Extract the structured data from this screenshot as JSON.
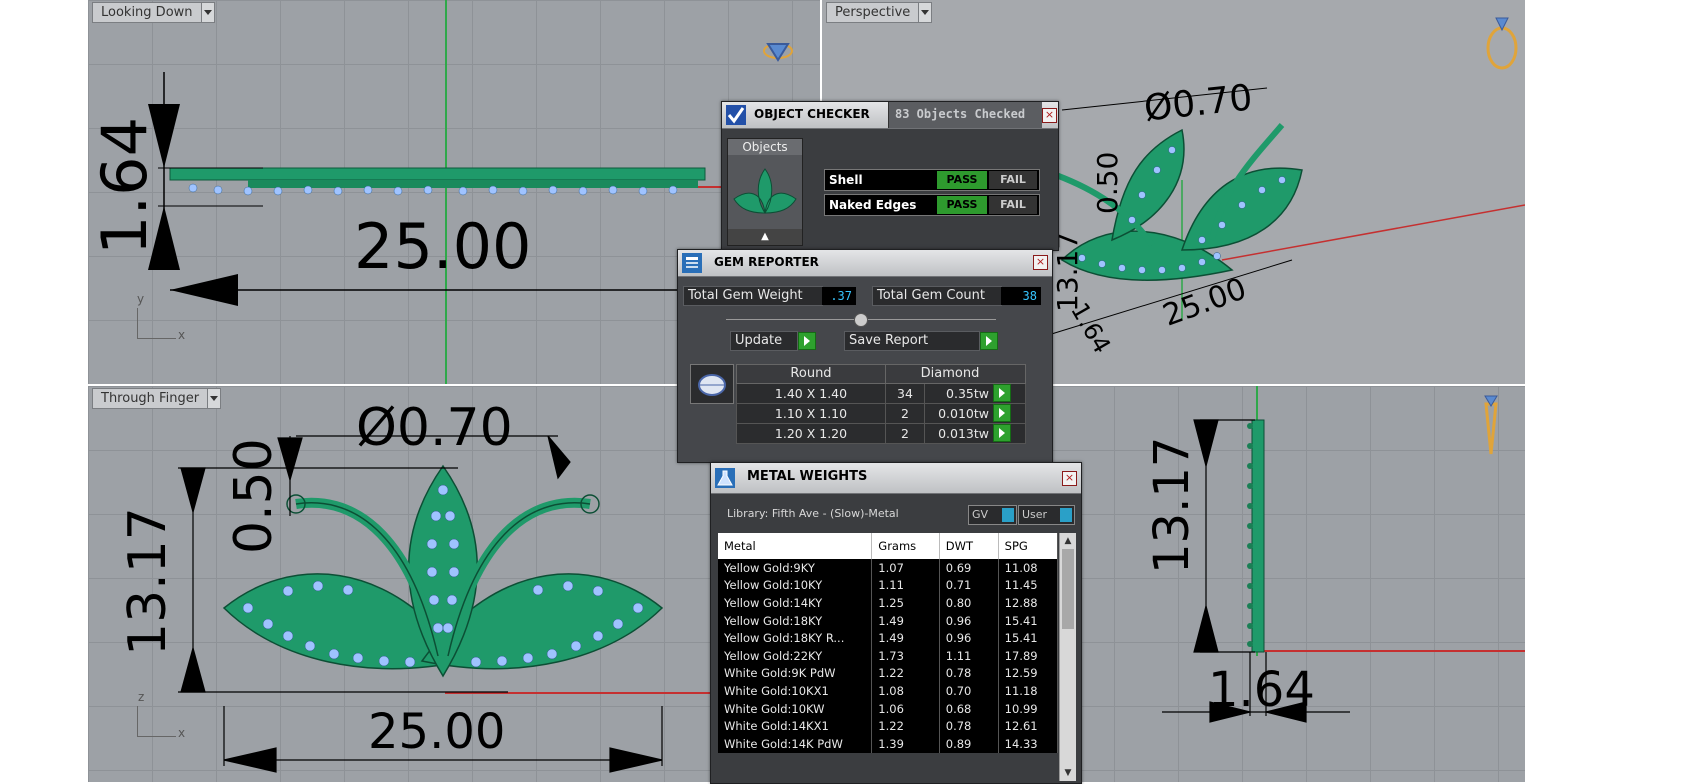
{
  "viewports": {
    "top": {
      "label": "Looking Down",
      "dim_height": "1.64",
      "dim_width": "25.00",
      "axis_y": "y",
      "axis_x": "x"
    },
    "perspective": {
      "label": "Perspective",
      "dim_diameter": "Ø0.70",
      "dim_vertical": "0.50",
      "dim_height": "13.17",
      "dim_depth": "1.64",
      "dim_width": "25.00"
    },
    "front": {
      "label": "Through Finger",
      "dim_diameter": "Ø0.70",
      "dim_small": "0.50",
      "dim_height": "13.17",
      "dim_width": "25.00",
      "axis_z": "z",
      "axis_x": "x"
    },
    "side": {
      "dim_height": "13.17",
      "dim_depth": "1.64"
    }
  },
  "object_checker": {
    "title": "OBJECT CHECKER",
    "tab_status": "83 Objects Checked",
    "objects_label": "Objects",
    "checks": [
      {
        "name": "Shell",
        "pass": "PASS",
        "fail": "FAIL"
      },
      {
        "name": "Naked Edges",
        "pass": "PASS",
        "fail": "FAIL"
      }
    ]
  },
  "gem_reporter": {
    "title": "GEM REPORTER",
    "total_weight_label": "Total Gem Weight",
    "total_weight_value": ".37",
    "total_count_label": "Total Gem Count",
    "total_count_value": "38",
    "update_label": "Update",
    "save_label": "Save Report",
    "table": {
      "shape": "Round",
      "material": "Diamond",
      "rows": [
        {
          "size": "1.40 X 1.40",
          "count": "34",
          "weight": "0.35tw"
        },
        {
          "size": "1.10 X 1.10",
          "count": "2",
          "weight": "0.010tw"
        },
        {
          "size": "1.20 X 1.20",
          "count": "2",
          "weight": "0.013tw"
        }
      ]
    }
  },
  "metal_weights": {
    "title": "METAL WEIGHTS",
    "library": "Library: Fifth Ave - (Slow)-Metal",
    "gv_label": "GV",
    "user_label": "User",
    "headers": [
      "Metal",
      "Grams",
      "DWT",
      "SPG"
    ],
    "rows": [
      [
        "Yellow Gold:9KY",
        "1.07",
        "0.69",
        "11.08"
      ],
      [
        "Yellow Gold:10KY",
        "1.11",
        "0.71",
        "11.45"
      ],
      [
        "Yellow Gold:14KY",
        "1.25",
        "0.80",
        "12.88"
      ],
      [
        "Yellow Gold:18KY",
        "1.49",
        "0.96",
        "15.41"
      ],
      [
        "Yellow Gold:18KY R...",
        "1.49",
        "0.96",
        "15.41"
      ],
      [
        "Yellow Gold:22KY",
        "1.73",
        "1.11",
        "17.89"
      ],
      [
        "White Gold:9K PdW",
        "1.22",
        "0.78",
        "12.59"
      ],
      [
        "White Gold:10KX1",
        "1.08",
        "0.70",
        "11.18"
      ],
      [
        "White Gold:10KW",
        "1.06",
        "0.68",
        "10.99"
      ],
      [
        "White Gold:14KX1",
        "1.22",
        "0.78",
        "12.61"
      ],
      [
        "White Gold:14K PdW",
        "1.39",
        "0.89",
        "14.33"
      ]
    ]
  },
  "colors": {
    "model": "#1f9a6a",
    "gem": "#9fc3ff",
    "viewport": "#9da1a6",
    "pass": "#2e9a2e"
  }
}
